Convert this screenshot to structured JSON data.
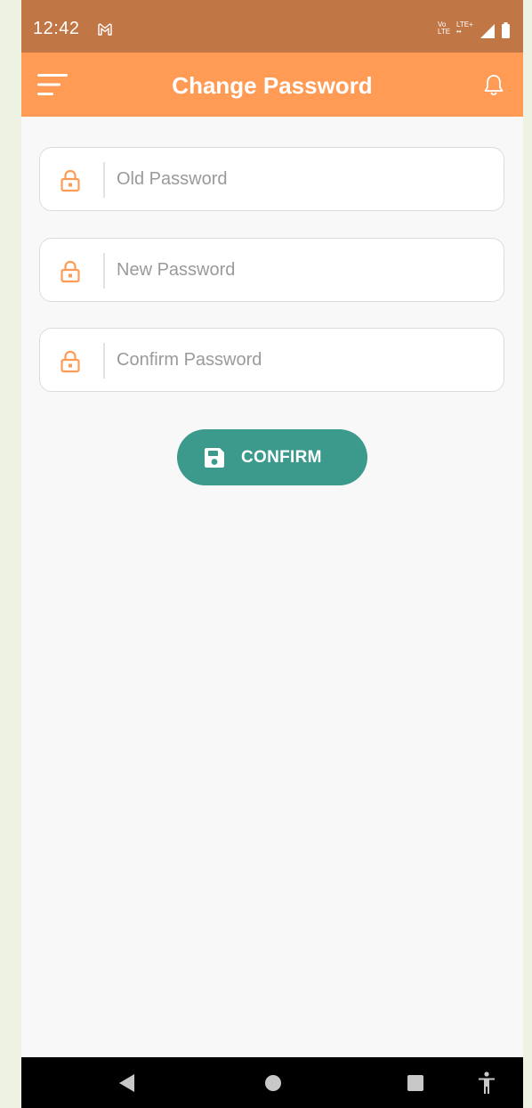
{
  "status_bar": {
    "time": "12:42",
    "net_label_1_top": "Vo",
    "net_label_1_bottom": "LTE",
    "net_label_2_top": "LTE+",
    "net_label_2_bottom": "",
    "icons": [
      "gmail-icon",
      "volte-icon",
      "signal-icon",
      "battery-icon"
    ]
  },
  "app_bar": {
    "title": "Change Password",
    "icons": [
      "menu-icon",
      "bell-icon"
    ]
  },
  "form": {
    "fields": [
      {
        "placeholder": "Old Password",
        "icon": "lock-icon"
      },
      {
        "placeholder": "New Password",
        "icon": "lock-icon"
      },
      {
        "placeholder": "Confirm Password",
        "icon": "lock-icon"
      }
    ],
    "confirm_button": {
      "label": "CONFIRM",
      "icon": "save-icon"
    }
  },
  "nav_bar": {
    "icons": [
      "back-icon",
      "home-icon",
      "recents-icon",
      "accessibility-icon"
    ]
  },
  "colors": {
    "status_bar": "#c07645",
    "app_bar": "#ff9b55",
    "accent_orange": "#ff9b55",
    "button": "#3b9a8c",
    "background": "#f8f8f8"
  }
}
